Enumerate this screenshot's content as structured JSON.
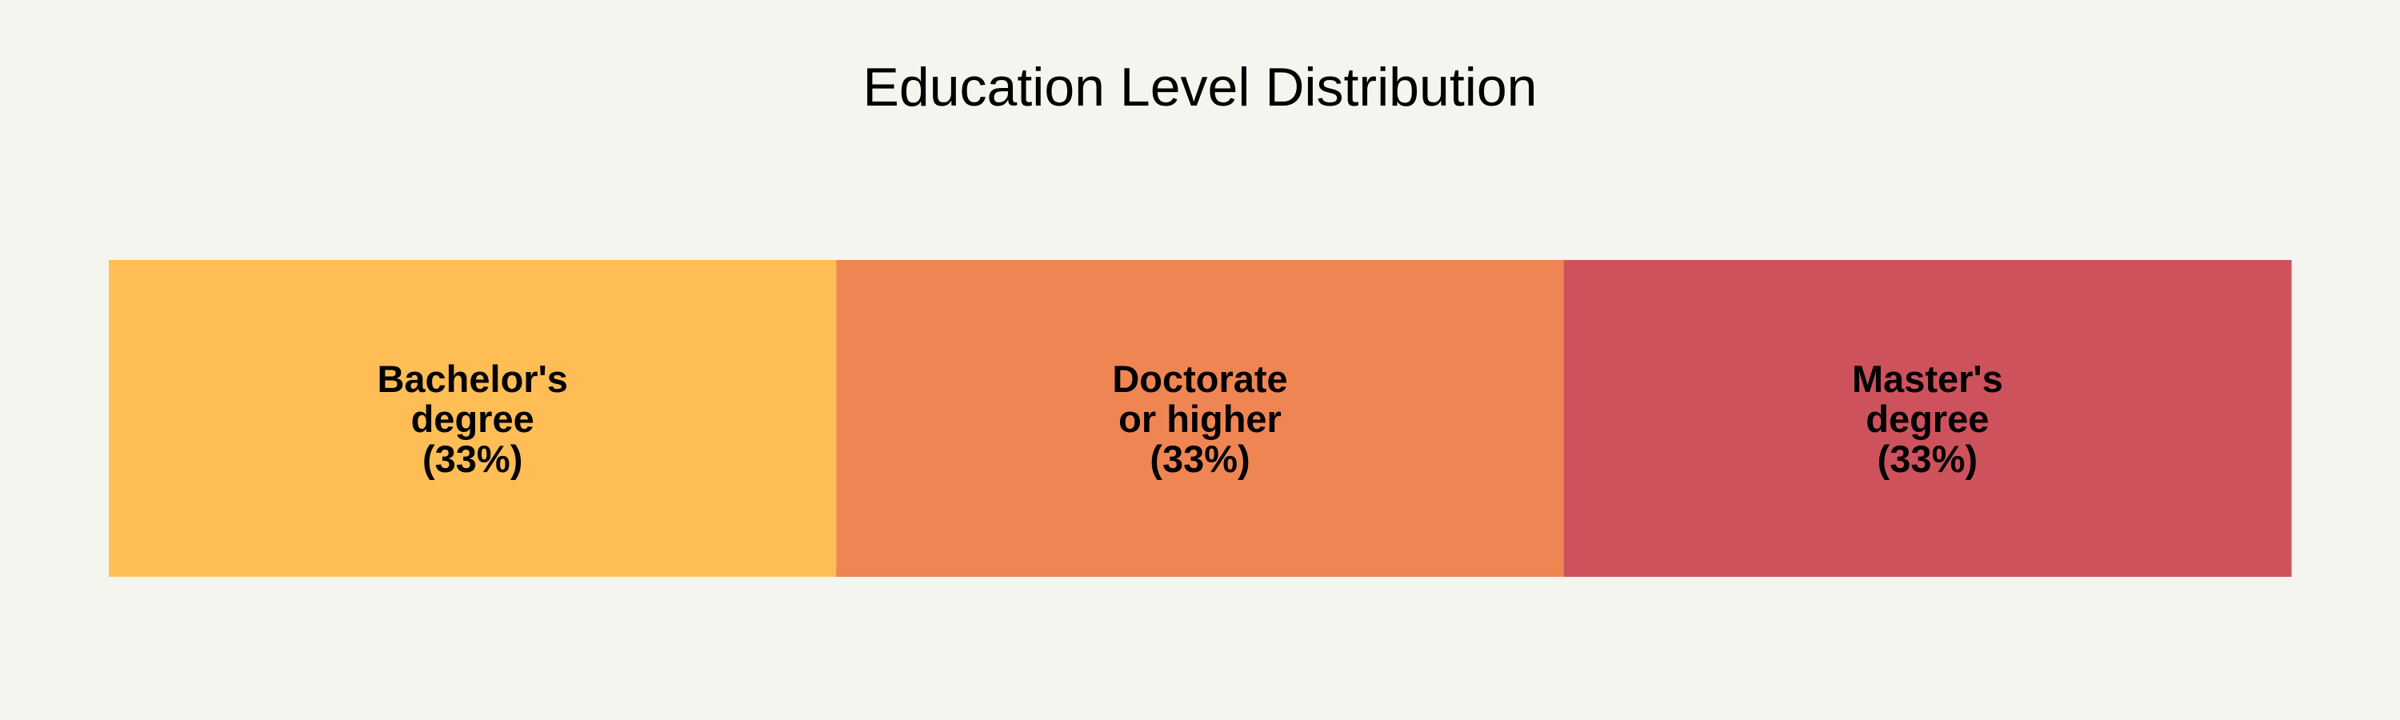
{
  "chart_data": {
    "type": "bar",
    "subtype": "stacked-100-horizontal",
    "title": "Education Level Distribution",
    "categories": [
      "Bachelor's degree",
      "Doctorate or higher",
      "Master's degree"
    ],
    "label_lines": [
      [
        "Bachelor's",
        "degree",
        "(33%)"
      ],
      [
        "Doctorate",
        "or higher",
        "(33%)"
      ],
      [
        "Master's",
        "degree",
        "(33%)"
      ]
    ],
    "values": [
      33.33,
      33.33,
      33.33
    ],
    "percent_labels": [
      "(33%)",
      "(33%)",
      "(33%)"
    ],
    "colors": [
      "#ffbd55",
      "#f08554",
      "#ce525c"
    ],
    "background": "#f5f5f0",
    "grid": false,
    "legend": "none"
  }
}
